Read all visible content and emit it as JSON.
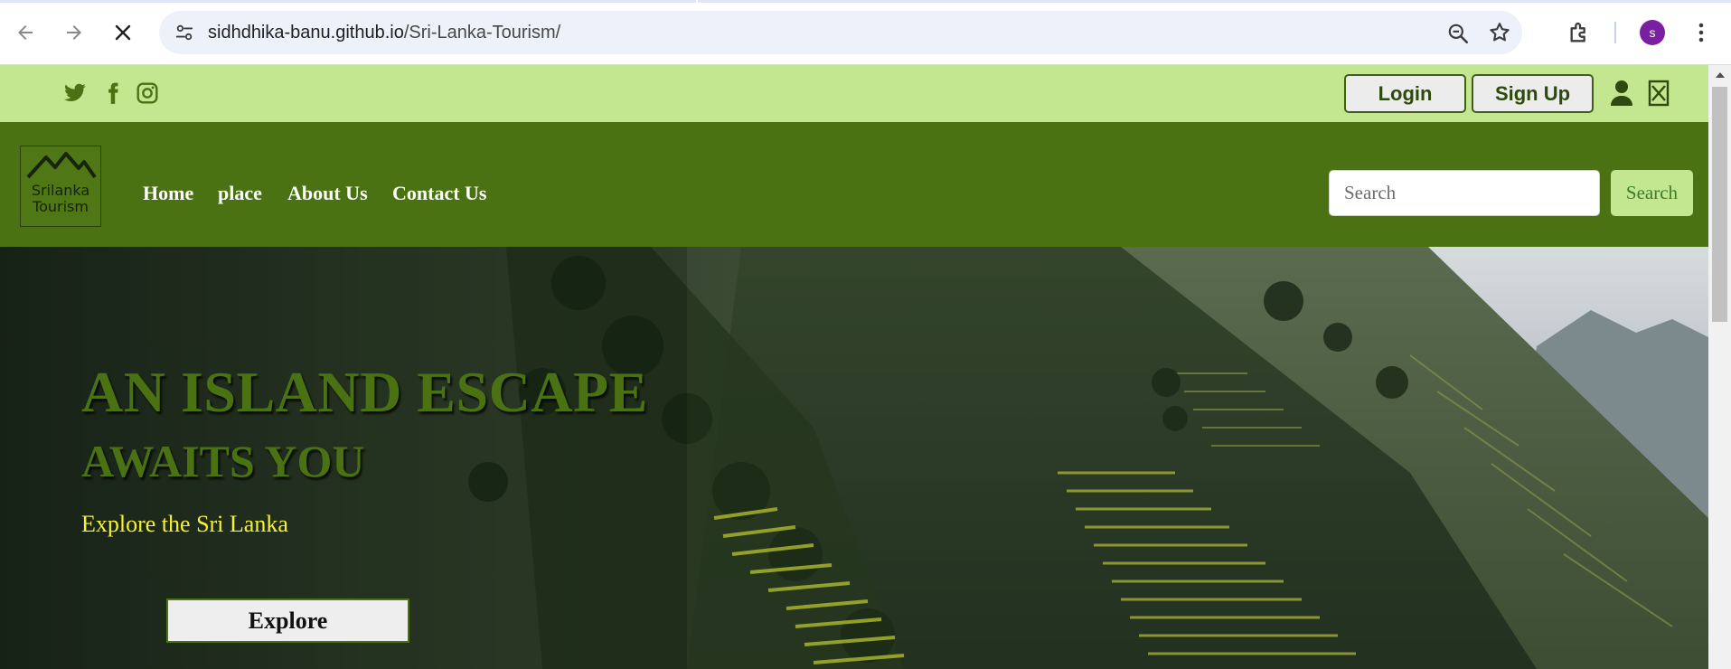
{
  "browser": {
    "url_host": "sidhdhika-banu.github.io",
    "url_path": "/Sri-Lanka-Tourism/",
    "profile_initial": "s",
    "icons": [
      "back-arrow-icon",
      "forward-arrow-icon",
      "stop-loading-icon",
      "site-info-icon",
      "zoom-icon",
      "bookmark-star-icon",
      "extensions-icon",
      "kebab-menu-icon"
    ]
  },
  "topbar": {
    "social_icons": [
      "twitter-icon",
      "facebook-icon",
      "instagram-icon"
    ],
    "login_label": "Login",
    "signup_label": "Sign Up",
    "icons": [
      "user-icon",
      "close-box-icon"
    ],
    "bg_color": "#c3e690"
  },
  "nav": {
    "logo_line1": "Srilanka",
    "logo_line2": "Tourism",
    "links": [
      "Home",
      "place",
      "About Us",
      "Contact Us"
    ],
    "search_placeholder": "Search",
    "search_button": "Search",
    "bg_color": "#4a7213"
  },
  "hero": {
    "title_line1": "AN ISLAND ESCAPE",
    "title_line2": "AWAITS YOU",
    "subtitle": "Explore the Sri Lanka",
    "cta": "Explore",
    "title_color": "#4a7213",
    "subtitle_color": "#f7f230"
  }
}
